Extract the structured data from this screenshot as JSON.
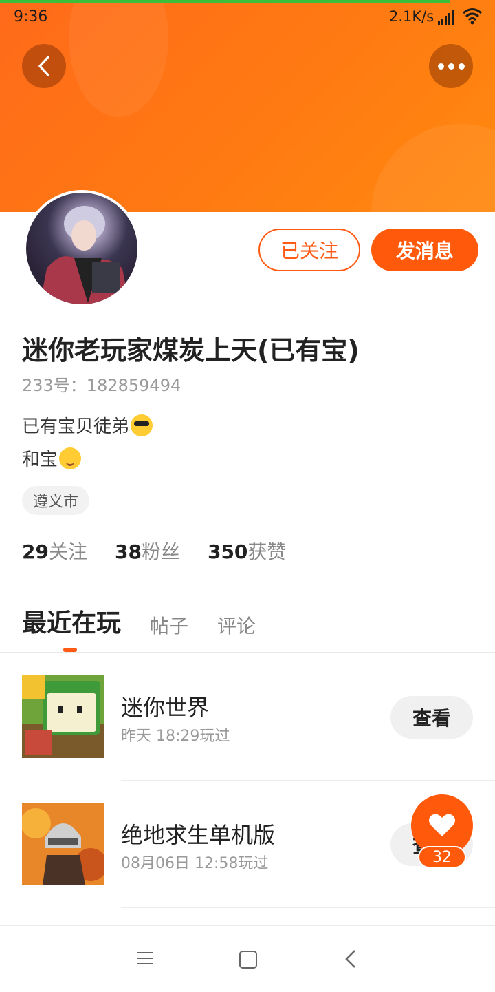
{
  "status_bar": {
    "time": "9:36",
    "network_speed": "2.1K/s"
  },
  "header": {
    "back_icon": "chevron-left-icon",
    "more_icon": "more-dots-icon"
  },
  "profile": {
    "follow_label": "已关注",
    "message_label": "发消息",
    "username": "迷你老玩家煤炭上天(已有宝)",
    "user_id": "233号：182859494",
    "bio_lines": [
      {
        "text": "已有宝贝徒弟",
        "emoji": "sunglasses-emoji"
      },
      {
        "text": "和宝",
        "emoji": "hugging-emoji"
      }
    ],
    "city": "遵义市",
    "stats": [
      {
        "num": "29",
        "label": "关注"
      },
      {
        "num": "38",
        "label": "粉丝"
      },
      {
        "num": "350",
        "label": "获赞"
      }
    ]
  },
  "tabs": [
    "最近在玩",
    "帖子",
    "评论"
  ],
  "games": [
    {
      "name": "迷你世界",
      "time": "昨天 18:29玩过",
      "button": "查看"
    },
    {
      "name": "绝地求生单机版",
      "time": "08月06日 12:58玩过",
      "button": "查看"
    }
  ],
  "like_fab": {
    "icon": "heart-icon",
    "count": "32"
  },
  "colors": {
    "accent": "#ff5a0c",
    "header_gradient": "#ff6a1a"
  }
}
